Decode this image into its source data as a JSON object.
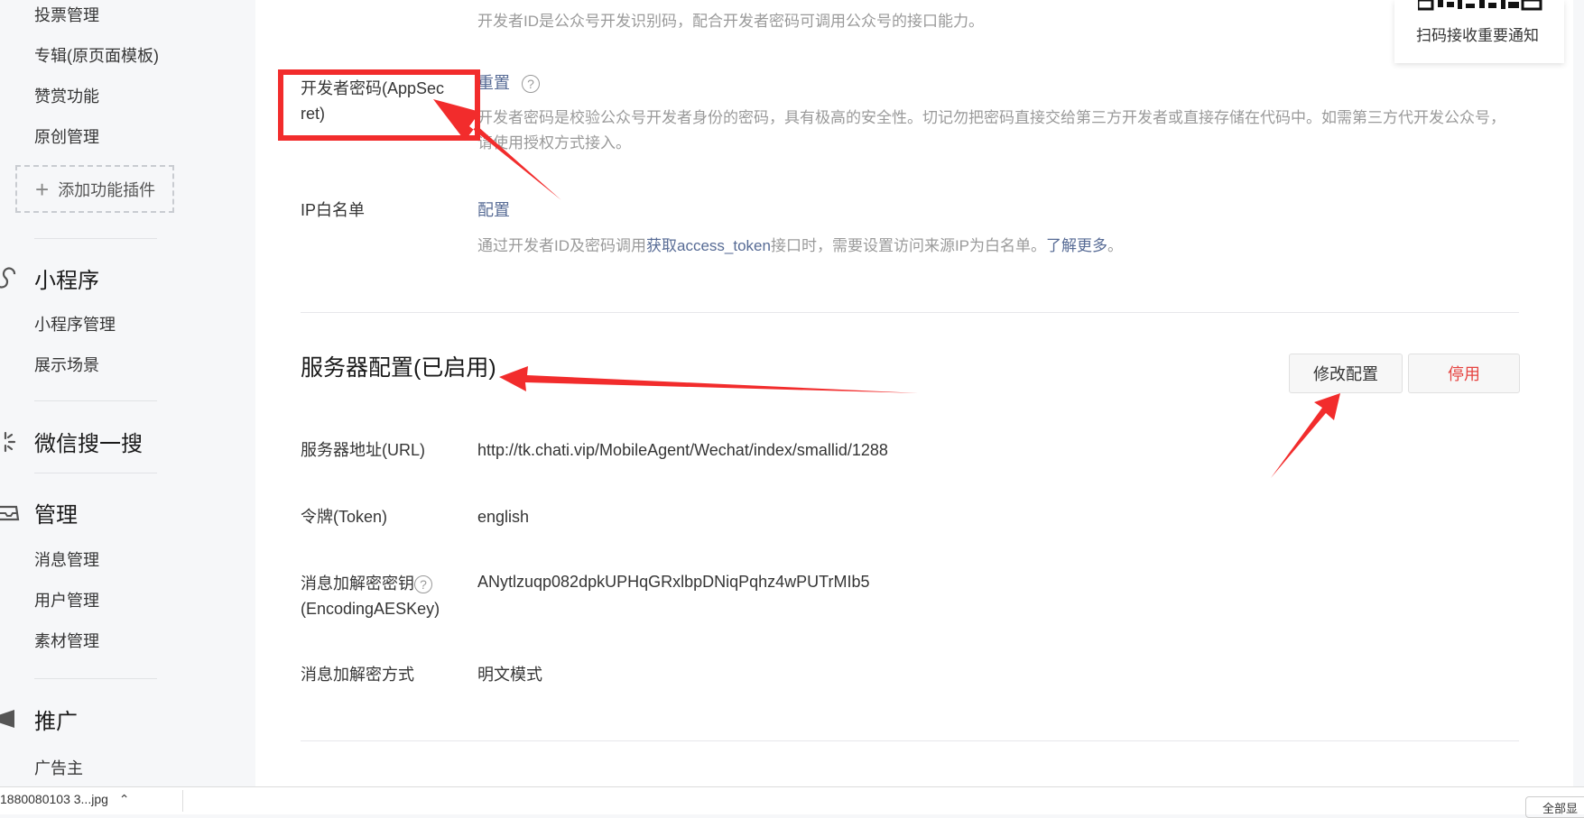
{
  "sidebar": {
    "items_top": [
      "投票管理",
      "专辑(原页面模板)",
      "赞赏功能",
      "原创管理"
    ],
    "add_plugin": "添加功能插件",
    "groups": {
      "miniprogram": {
        "title": "小程序",
        "items": [
          "小程序管理",
          "展示场景"
        ]
      },
      "search": {
        "title": "微信搜一搜"
      },
      "manage": {
        "title": "管理",
        "items": [
          "消息管理",
          "用户管理",
          "素材管理"
        ]
      },
      "promo": {
        "title": "推广",
        "items": [
          "广告主"
        ]
      }
    }
  },
  "dev": {
    "appid_desc": "开发者ID是公众号开发识别码，配合开发者密码可调用公众号的接口能力。",
    "secret_label": "开发者密码(AppSecret)",
    "secret_label_line1": "开发者密码(AppSec",
    "secret_label_line2": "ret)",
    "reset": "重置",
    "help": "?",
    "secret_desc": "开发者密码是校验公众号开发者身份的密码，具有极高的安全性。切记勿把密码直接交给第三方开发者或直接存储在代码中。如需第三方代开发公众号，请使用授权方式接入。",
    "ip_label": "IP白名单",
    "ip_config": "配置",
    "ip_desc_pre": "通过开发者ID及密码调用",
    "ip_desc_link": "获取access_token",
    "ip_desc_mid": "接口时，需要设置访问来源IP为白名单。",
    "ip_desc_more": "了解更多",
    "ip_desc_end": "。"
  },
  "server": {
    "title": "服务器配置(已启用)",
    "modify_btn": "修改配置",
    "disable_btn": "停用",
    "url_label": "服务器地址(URL)",
    "url_value": "http://tk.chati.vip/MobileAgent/Wechat/index/smallid/1288",
    "token_label": "令牌(Token)",
    "token_value": "english",
    "aes_label_1": "消息加解密密钥",
    "aes_label_2": "(EncodingAESKey)",
    "aes_value": "ANytlzuqp082dpkUPHqGRxlbpDNiqPqhz4wPUTrMIb5",
    "mode_label": "消息加解密方式",
    "mode_value": "明文模式"
  },
  "qr": {
    "text": "扫码接收重要通知"
  },
  "download_bar": {
    "file": "1880080103 3...jpg",
    "show_all": "全部显"
  },
  "colors": {
    "link": "#576b95",
    "danger": "#e64340",
    "annotation": "#f22c2c"
  }
}
